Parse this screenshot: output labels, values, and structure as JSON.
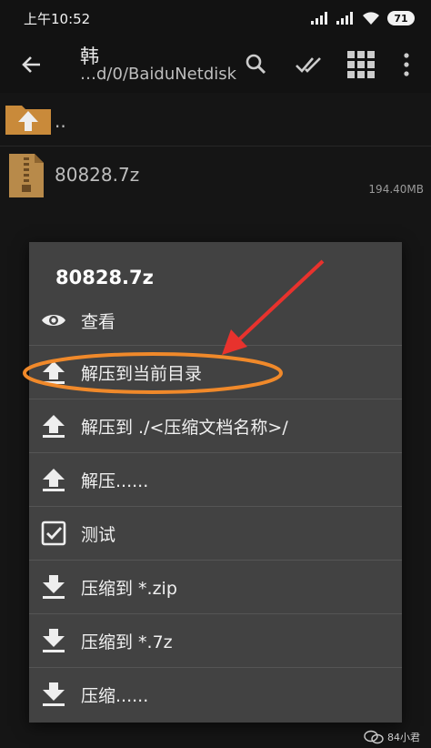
{
  "status": {
    "time": "上午10:52",
    "battery": "71"
  },
  "toolbar": {
    "title": "韩",
    "path": "…d/0/BaiduNetdisk"
  },
  "files": [
    {
      "name": "..",
      "size": ""
    },
    {
      "name": "80828.7z",
      "size": "194.40MB"
    }
  ],
  "dialog": {
    "title": "80828.7z",
    "items": [
      {
        "label": "查看",
        "icon": "eye-icon"
      },
      {
        "label": "解压到当前目录",
        "icon": "upload-arrow-icon"
      },
      {
        "label": "解压到 ./<压缩文档名称>/",
        "icon": "upload-arrow-icon"
      },
      {
        "label": "解压......",
        "icon": "upload-arrow-icon"
      },
      {
        "label": "测试",
        "icon": "checkbox-icon"
      },
      {
        "label": "压缩到 *.zip",
        "icon": "download-arrow-icon"
      },
      {
        "label": "压缩到 *.7z",
        "icon": "download-arrow-icon"
      },
      {
        "label": "压缩......",
        "icon": "download-arrow-icon"
      }
    ]
  },
  "watermark": {
    "text": "84小君"
  },
  "colors": {
    "background": "#151515",
    "dialog": "#424242",
    "folder": "#c98a3a",
    "annotation_red": "#e8322d",
    "annotation_orange": "#f0892a"
  }
}
